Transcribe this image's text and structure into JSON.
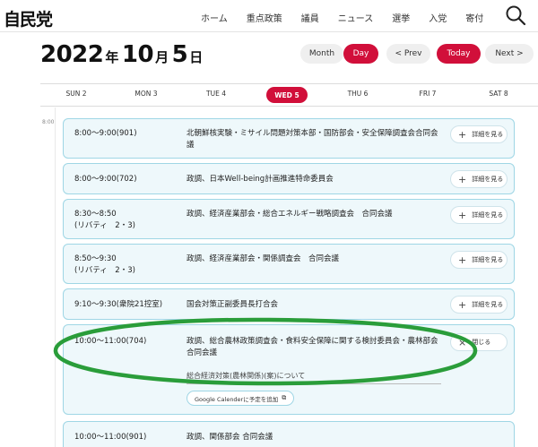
{
  "header": {
    "logo": "自民党",
    "nav": [
      "ホーム",
      "重点政策",
      "議員",
      "ニュース",
      "選挙",
      "入党",
      "寄付"
    ]
  },
  "calendar": {
    "year": "2022",
    "year_unit": "年",
    "month": "10",
    "month_unit": "月",
    "day": "5",
    "day_unit": "日",
    "buttons": {
      "month": "Month",
      "day": "Day",
      "prev": "< Prev",
      "today": "Today",
      "next": "Next >"
    },
    "days": [
      "SUN 2",
      "MON 3",
      "TUE 4",
      "WED 5",
      "THU 6",
      "FRI 7",
      "SAT 8"
    ],
    "active_day_index": 3,
    "time_label": "8:00"
  },
  "events": [
    {
      "time": "8:00～9:00(901)",
      "title": "北朝鮮核実験・ミサイル問題対策本部・国防部会・安全保障調査会合同会議",
      "button": "詳細を見る"
    },
    {
      "time": "8:00～9:00(702)",
      "title": "政調、日本Well-being計画推進特命委員会",
      "button": "詳細を見る"
    },
    {
      "time": "8:30～8:50\n(リバティ　2・3)",
      "title": "政調、経済産業部会・総合エネルギー戦略調査会　合同会議",
      "button": "詳細を見る"
    },
    {
      "time": "8:50～9:30\n(リバティ　2・3)",
      "title": "政調、経済産業部会・関係調査会　合同会議",
      "button": "詳細を見る"
    },
    {
      "time": "9:10～9:30(衆院21控室)",
      "title": "国会対策正副委員長打合会",
      "button": "詳細を見る"
    },
    {
      "time": "10:00～11:00(704)",
      "title": "政調、総合農林政策調査会・食料安全保障に関する検討委員会・農林部会合同会議",
      "button": "閉じる",
      "detail": "総合経済対策(農林関係)(案)について",
      "gcal": "Google Calenderに予定を追加"
    },
    {
      "time": "10:00～11:00(901)",
      "title": "政調、関係部会 合同会議",
      "button": ""
    }
  ],
  "colors": {
    "accent": "#d10f3a",
    "card_border": "#9fd6e5",
    "card_bg": "#eef8fb",
    "annotation": "#2a9d3a"
  }
}
